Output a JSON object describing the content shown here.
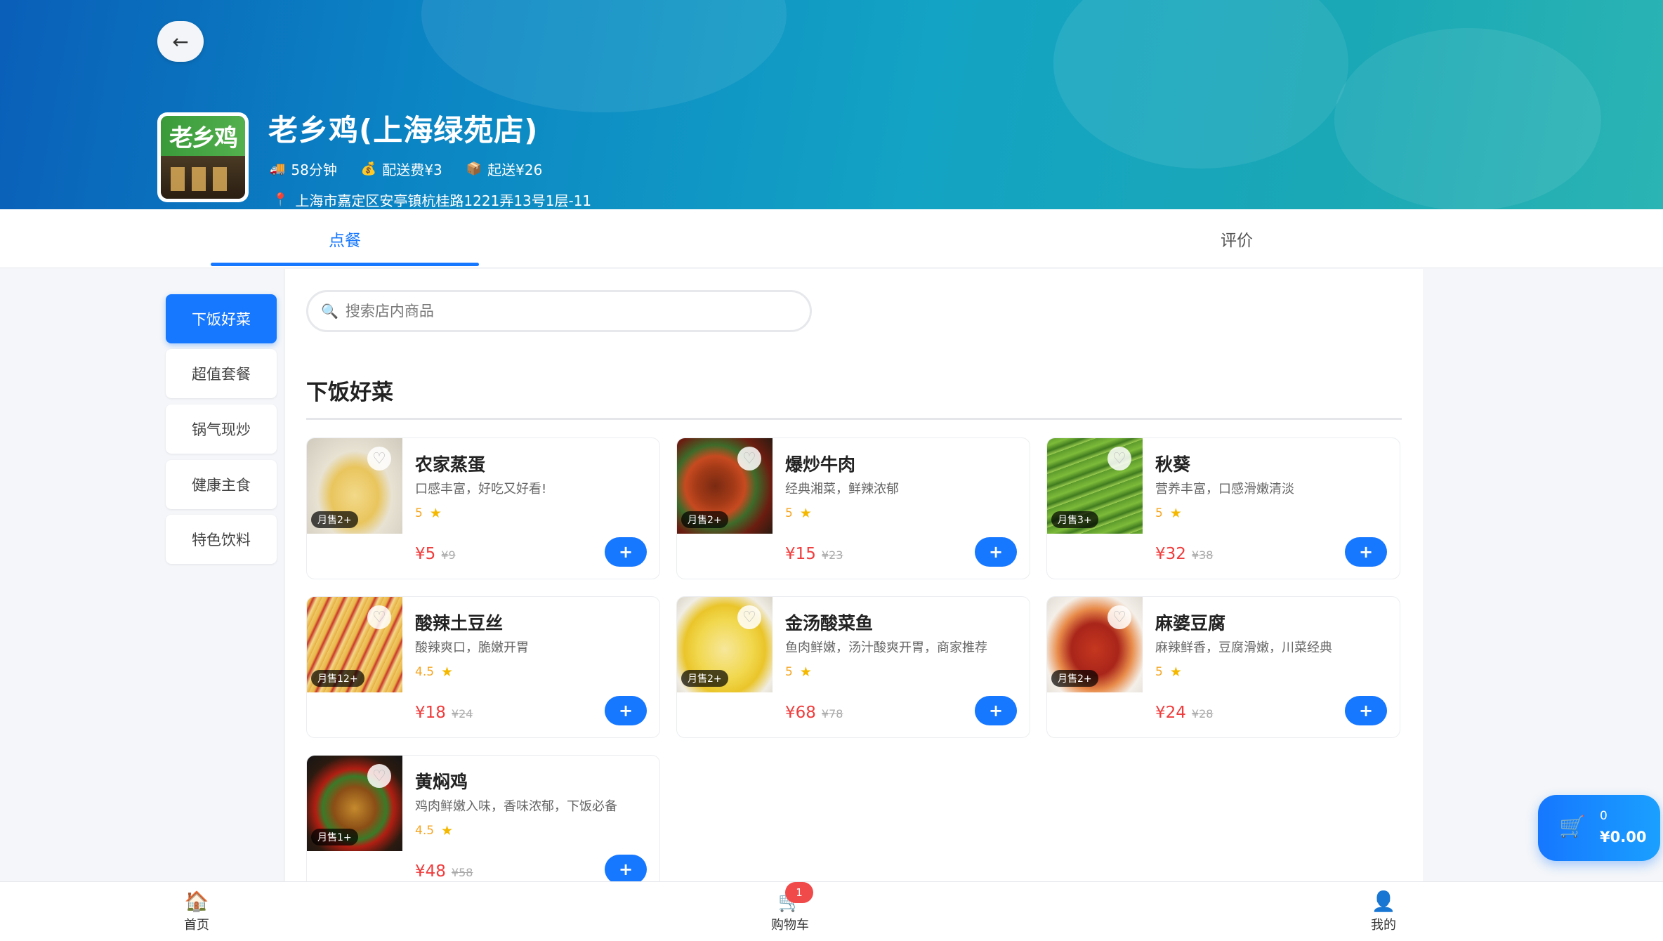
{
  "header": {
    "back_glyph": "←",
    "store_logo_text": "老乡鸡",
    "store_name": "老乡鸡(上海绿苑店)",
    "delivery_time": "58分钟",
    "delivery_fee": "配送费¥3",
    "min_order": "起送¥26",
    "address": "上海市嘉定区安亭镇杭桂路1221弄13号1层-11"
  },
  "tabs": {
    "order": "点餐",
    "review": "评价",
    "active": "点餐"
  },
  "categories": [
    "下饭好菜",
    "超值套餐",
    "锅气现炒",
    "健康主食",
    "特色饮料"
  ],
  "active_category": "下饭好菜",
  "search": {
    "placeholder": "搜索店内商品",
    "value": ""
  },
  "section_title": "下饭好菜",
  "products": [
    {
      "name": "农家蒸蛋",
      "desc": "口感丰富，好吃又好看!",
      "rating": "5",
      "price": "¥5",
      "original_price": "¥9",
      "sold": "月售2+",
      "image": "steamed-egg"
    },
    {
      "name": "爆炒牛肉",
      "desc": "经典湘菜，鲜辣浓郁",
      "rating": "5",
      "price": "¥15",
      "original_price": "¥23",
      "sold": "月售2+",
      "image": "stir-fried-beef"
    },
    {
      "name": "秋葵",
      "desc": "营养丰富，口感滑嫩清淡",
      "rating": "5",
      "price": "¥32",
      "original_price": "¥38",
      "sold": "月售3+",
      "image": "okra"
    },
    {
      "name": "酸辣土豆丝",
      "desc": "酸辣爽口，脆嫩开胃",
      "rating": "4.5",
      "price": "¥18",
      "original_price": "¥24",
      "sold": "月售12+",
      "image": "potato-shreds"
    },
    {
      "name": "金汤酸菜鱼",
      "desc": "鱼肉鲜嫩，汤汁酸爽开胃，商家推荐",
      "rating": "5",
      "price": "¥68",
      "original_price": "¥78",
      "sold": "月售2+",
      "image": "sauerkraut-fish"
    },
    {
      "name": "麻婆豆腐",
      "desc": "麻辣鲜香，豆腐滑嫩，川菜经典",
      "rating": "5",
      "price": "¥24",
      "original_price": "¥28",
      "sold": "月售2+",
      "image": "mapo-tofu"
    },
    {
      "name": "黄焖鸡",
      "desc": "鸡肉鲜嫩入味，香味浓郁，下饭必备",
      "rating": "4.5",
      "price": "¥48",
      "original_price": "¥58",
      "sold": "月售1+",
      "image": "braised-chicken"
    }
  ],
  "add_glyph": "+",
  "floating_cart": {
    "count": "0",
    "total": "¥0.00"
  },
  "bottom_nav": {
    "home": "首页",
    "cart": "购物车",
    "me": "我的",
    "cart_badge": "1"
  },
  "colors": {
    "accent": "#1677ff",
    "price": "#f03c3c",
    "badge": "#f04a4a",
    "star": "#f5b800"
  }
}
